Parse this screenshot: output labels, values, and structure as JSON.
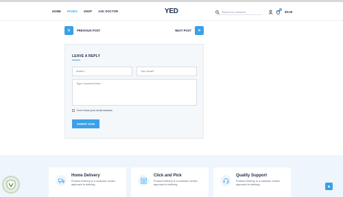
{
  "header": {
    "nav": [
      "HOME",
      "PAGES",
      "SHOP",
      "ASK DOCTOR"
    ],
    "active_nav": "PAGES",
    "logo": "YED",
    "search_placeholder": "Search for medicine",
    "cart_count": "0",
    "cart_total": "$0.00"
  },
  "post_nav": {
    "prev_label": "PREVIOUS POST",
    "next_label": "NEXT POST"
  },
  "reply": {
    "title": "LEAVE A REPLY",
    "author_placeholder": "Author *",
    "email_placeholder": "Your Email *",
    "comment_placeholder": "Type Comment Here...",
    "consent_text": "Don't show your email address",
    "submit_label": "SUBMIT NOW"
  },
  "features": [
    {
      "title": "Home Delivery",
      "text": "Product Delivery is a customer-centric approach to defining.",
      "icon": "truck-icon"
    },
    {
      "title": "Click and Pick",
      "text": "Product Delivery is a customer-centric approach to defining.",
      "icon": "store-icon"
    },
    {
      "title": "Quality Support",
      "text": "Product Delivery is a customer-centric approach to defining.",
      "icon": "headset-icon"
    }
  ],
  "colors": {
    "accent": "#3aa0e8",
    "dark": "#1f2a44",
    "panel": "#f4f8fb",
    "footer_bg": "#eef5fc"
  }
}
